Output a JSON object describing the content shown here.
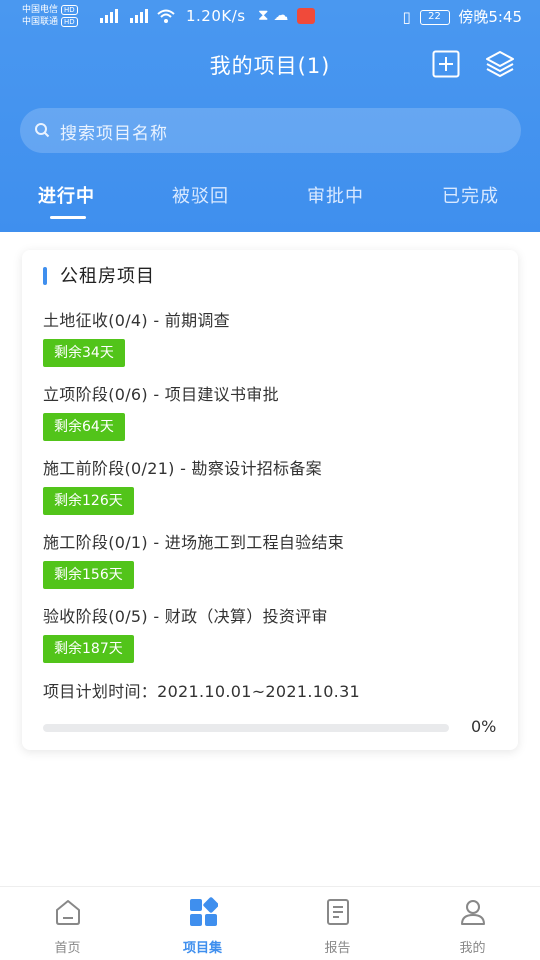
{
  "status_bar": {
    "carrier1": "中国电信",
    "carrier2": "中国联通",
    "hd": "HD",
    "speed": "1.20K/s",
    "battery": "22",
    "time": "傍晚5:45"
  },
  "header": {
    "title": "我的项目(1)"
  },
  "search": {
    "placeholder": "搜索项目名称"
  },
  "tabs": [
    {
      "label": "进行中",
      "active": true
    },
    {
      "label": "被驳回",
      "active": false
    },
    {
      "label": "审批中",
      "active": false
    },
    {
      "label": "已完成",
      "active": false
    }
  ],
  "project": {
    "name": "公租房项目",
    "phases": [
      {
        "title": "土地征收(0/4) - 前期调查",
        "remaining": "剩余34天"
      },
      {
        "title": "立项阶段(0/6) - 项目建议书审批",
        "remaining": "剩余64天"
      },
      {
        "title": "施工前阶段(0/21) - 勘察设计招标备案",
        "remaining": "剩余126天"
      },
      {
        "title": "施工阶段(0/1) - 进场施工到工程自验结束",
        "remaining": "剩余156天"
      },
      {
        "title": "验收阶段(0/5) - 财政（决算）投资评审",
        "remaining": "剩余187天"
      }
    ],
    "plan_time": "项目计划时间：2021.10.01~2021.10.31",
    "progress_percent": 0,
    "progress_label": "0%"
  },
  "bottom_nav": [
    {
      "label": "首页",
      "icon": "home-icon",
      "active": false
    },
    {
      "label": "项目集",
      "icon": "grid-icon",
      "active": true
    },
    {
      "label": "报告",
      "icon": "report-icon",
      "active": false
    },
    {
      "label": "我的",
      "icon": "user-icon",
      "active": false
    }
  ],
  "colors": {
    "primary": "#3f8fee",
    "badge_green": "#52c41a"
  }
}
